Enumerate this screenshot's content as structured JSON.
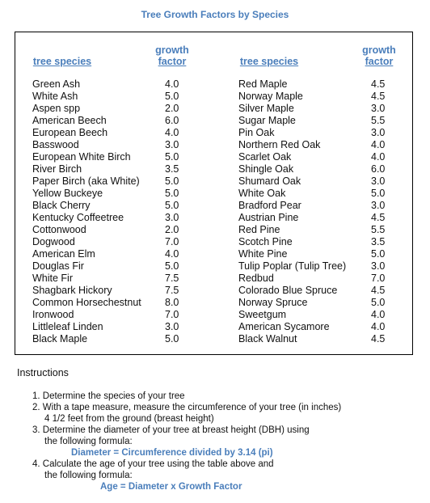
{
  "title": "Tree Growth Factors by Species",
  "headers": {
    "species": "tree species",
    "growth_line1": "growth",
    "growth_line2": "factor"
  },
  "left_column": [
    {
      "species": "Green Ash",
      "factor": "4.0"
    },
    {
      "species": "White Ash",
      "factor": "5.0"
    },
    {
      "species": "Aspen spp",
      "factor": "2.0"
    },
    {
      "species": "American Beech",
      "factor": "6.0"
    },
    {
      "species": "European Beech",
      "factor": "4.0"
    },
    {
      "species": "Basswood",
      "factor": "3.0"
    },
    {
      "species": "European White Birch",
      "factor": "5.0"
    },
    {
      "species": "River Birch",
      "factor": "3.5"
    },
    {
      "species": "Paper Birch (aka White)",
      "factor": "5.0"
    },
    {
      "species": "Yellow Buckeye",
      "factor": "5.0"
    },
    {
      "species": "Black Cherry",
      "factor": "5.0"
    },
    {
      "species": "Kentucky Coffeetree",
      "factor": "3.0"
    },
    {
      "species": "Cottonwood",
      "factor": "2.0"
    },
    {
      "species": "Dogwood",
      "factor": "7.0"
    },
    {
      "species": "American Elm",
      "factor": "4.0"
    },
    {
      "species": "Douglas Fir",
      "factor": "5.0"
    },
    {
      "species": "White Fir",
      "factor": "7.5"
    },
    {
      "species": "Shagbark Hickory",
      "factor": "7.5"
    },
    {
      "species": "Common Horsechestnut",
      "factor": "8.0"
    },
    {
      "species": "Ironwood",
      "factor": "7.0"
    },
    {
      "species": "Littleleaf Linden",
      "factor": "3.0"
    },
    {
      "species": "Black Maple",
      "factor": "5.0"
    }
  ],
  "right_column": [
    {
      "species": "Red Maple",
      "factor": "4.5"
    },
    {
      "species": "Norway Maple",
      "factor": "4.5"
    },
    {
      "species": "Silver Maple",
      "factor": "3.0"
    },
    {
      "species": "Sugar Maple",
      "factor": "5.5"
    },
    {
      "species": "Pin Oak",
      "factor": "3.0"
    },
    {
      "species": "Northern Red Oak",
      "factor": "4.0"
    },
    {
      "species": "Scarlet Oak",
      "factor": "4.0"
    },
    {
      "species": "Shingle Oak",
      "factor": "6.0"
    },
    {
      "species": "Shumard Oak",
      "factor": "3.0"
    },
    {
      "species": "White Oak",
      "factor": "5.0"
    },
    {
      "species": "Bradford Pear",
      "factor": "3.0"
    },
    {
      "species": "Austrian Pine",
      "factor": "4.5"
    },
    {
      "species": "Red Pine",
      "factor": "5.5"
    },
    {
      "species": "Scotch Pine",
      "factor": "3.5"
    },
    {
      "species": "White Pine",
      "factor": "5.0"
    },
    {
      "species": "Tulip Poplar (Tulip Tree)",
      "factor": "3.0"
    },
    {
      "species": "Redbud",
      "factor": "7.0"
    },
    {
      "species": "Colorado Blue Spruce",
      "factor": "4.5"
    },
    {
      "species": "Norway Spruce",
      "factor": "5.0"
    },
    {
      "species": "Sweetgum",
      "factor": "4.0"
    },
    {
      "species": "American Sycamore",
      "factor": "4.0"
    },
    {
      "species": "Black Walnut",
      "factor": "4.5"
    }
  ],
  "instructions": {
    "title": "Instructions",
    "step1": "1. Determine the species of your tree",
    "step2a": "2. With a tape measure, measure the circumference of your tree (in inches)",
    "step2b": "4 1/2 feet from the ground (breast height)",
    "step3a": "3. Determine the diameter of your tree at breast height (DBH) using",
    "step3b": "the following formula:",
    "formula1": "Diameter = Circumference divided by 3.14 (pi)",
    "step4a": "4. Calculate the age of your tree using the table above and",
    "step4b": "the following formula:",
    "formula2": "Age = Diameter x Growth Factor"
  },
  "colors": {
    "accent": "#4a7ebb",
    "text": "#111111",
    "border": "#000000"
  }
}
